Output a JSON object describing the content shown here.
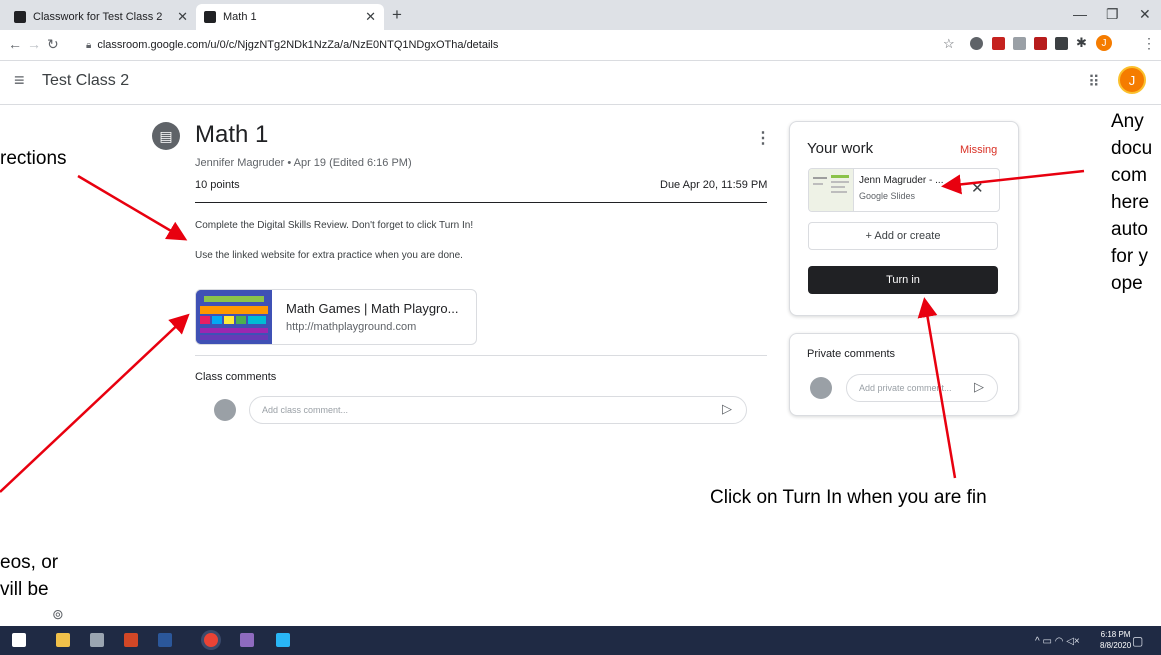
{
  "browser": {
    "tabs": [
      {
        "label": "Classwork for Test Class 2",
        "active": false
      },
      {
        "label": "Math 1",
        "active": true
      }
    ],
    "url": "classroom.google.com/u/0/c/NjgzNTg2NDk1NzZa/a/NzE0NTQ1NDgxOTha/details"
  },
  "app": {
    "class_name": "Test Class 2",
    "avatar_letter": "J"
  },
  "assignment": {
    "title": "Math 1",
    "meta": "Jennifer Magruder • Apr 19 (Edited 6:16 PM)",
    "points": "10 points",
    "due": "Due Apr 20, 11:59 PM",
    "description": [
      "Complete the Digital Skills Review. Don't forget to click Turn In!",
      "Use the linked website for extra practice when you are done."
    ],
    "link": {
      "title": "Math Games | Math Playgro...",
      "url": "http://mathplayground.com"
    },
    "class_comments_label": "Class comments",
    "class_comment_placeholder": "Add class comment..."
  },
  "your_work": {
    "label": "Your work",
    "status": "Missing",
    "file_name": "Jenn Magruder - ...",
    "file_type": "Google Slides",
    "add_label": "+ Add or create",
    "turn_in_label": "Turn in"
  },
  "private_comments": {
    "label": "Private comments",
    "placeholder": "Add private comment..."
  },
  "annotations": {
    "directions": "rections",
    "right_lines": [
      "Any",
      "docu",
      "com",
      "here",
      "auto",
      "for y",
      "ope"
    ],
    "turn_in_hint": "Click on Turn In when you are fin",
    "left_lines": [
      "eos, or",
      "vill be"
    ]
  },
  "taskbar": {
    "time": "6:18 PM",
    "date": "8/8/2020"
  },
  "colors": {
    "missing": "#d93025",
    "turn_in_bg": "#202124",
    "avatar": "#f57c00",
    "arrow": "#e8000f",
    "taskbar": "#1f2a44"
  }
}
